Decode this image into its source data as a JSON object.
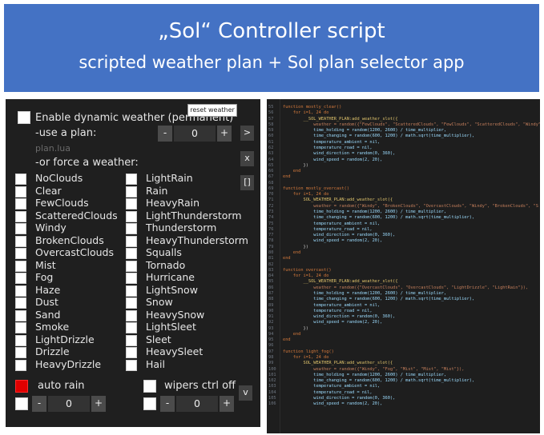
{
  "banner": {
    "title": "„Sol“ Controller script",
    "subtitle": "scripted weather plan + Sol plan selector app"
  },
  "app": {
    "tooltip": "reset weather",
    "enable_label": "Enable dynamic weather (permanent)",
    "use_plan_label": "-use a plan:",
    "plan_value": "0",
    "plan_file": "plan.lua",
    "force_label": "-or force a weather:",
    "next_button": ">",
    "close_button": "x",
    "brackets_button": "[]",
    "v_button": "v",
    "minus": "-",
    "plus": "+",
    "weathers_left": [
      "NoClouds",
      "Clear",
      "FewClouds",
      "ScatteredClouds",
      "Windy",
      "BrokenClouds",
      "OvercastClouds",
      "Mist",
      "Fog",
      "Haze",
      "Dust",
      "Sand",
      "Smoke",
      "LightDrizzle",
      "Drizzle",
      "HeavyDrizzle"
    ],
    "weathers_right": [
      "LightRain",
      "Rain",
      "HeavyRain",
      "LightThunderstorm",
      "Thunderstorm",
      "HeavyThunderstorm",
      "Squalls",
      "Tornado",
      "Hurricane",
      "LightSnow",
      "Snow",
      "HeavySnow",
      "LightSleet",
      "Sleet",
      "HeavySleet",
      "Hail"
    ],
    "auto_rain_label": "auto rain",
    "auto_rain_value": "0",
    "wipers_label": "wipers ctrl off",
    "wipers_value": "0",
    "colors": {
      "accent_red": "#e00000",
      "panel": "#1f1f1f",
      "banner": "#4472c4"
    }
  },
  "code": {
    "lines": [
      {
        "n": "55",
        "t": "function mostly_clear()"
      },
      {
        "n": "56",
        "t": "    for i=1, 24 do"
      },
      {
        "n": "57",
        "t": "        __SOL_WEATHER_PLAN:add_weather_slot({"
      },
      {
        "n": "58",
        "t": "            weather = random({\"FewClouds\", \"ScatteredClouds\", \"FewClouds\", \"ScatteredClouds\", \"Windy\""
      },
      {
        "n": "59",
        "t": "            time_holding = random(1200, 2600) / time_multiplier,"
      },
      {
        "n": "60",
        "t": "            time_changing = random(600, 1200) / math.sqrt(time_multiplier),"
      },
      {
        "n": "61",
        "t": "            temperature_ambient = nil,"
      },
      {
        "n": "62",
        "t": "            temperature_road = nil,"
      },
      {
        "n": "63",
        "t": "            wind_direction = random(0, 360),"
      },
      {
        "n": "64",
        "t": "            wind_speed = random(2, 20),"
      },
      {
        "n": "65",
        "t": "        })"
      },
      {
        "n": "66",
        "t": "    end"
      },
      {
        "n": "67",
        "t": "end"
      },
      {
        "n": "68",
        "t": ""
      },
      {
        "n": "69",
        "t": "function mostly_overcast()"
      },
      {
        "n": "70",
        "t": "    for i=1, 24 do"
      },
      {
        "n": "71",
        "t": "        SOL_WEATHER_PLAN:add_weather_slot({"
      },
      {
        "n": "72",
        "t": "            weather = random({\"Windy\", \"BrokenClouds\", \"OvercastClouds\", \"Windy\", \"BrokenClouds\", \"S"
      },
      {
        "n": "73",
        "t": "            time_holding = random(1200, 2600) / time_multiplier,"
      },
      {
        "n": "74",
        "t": "            time_changing = random(600, 1200) / math.sqrt(time_multiplier),"
      },
      {
        "n": "75",
        "t": "            temperature_ambient = nil,"
      },
      {
        "n": "76",
        "t": "            temperature_road = nil,"
      },
      {
        "n": "77",
        "t": "            wind_direction = random(0, 360),"
      },
      {
        "n": "78",
        "t": "            wind_speed = random(2, 20),"
      },
      {
        "n": "79",
        "t": "        })"
      },
      {
        "n": "80",
        "t": "    end"
      },
      {
        "n": "81",
        "t": "end"
      },
      {
        "n": "82",
        "t": ""
      },
      {
        "n": "83",
        "t": "function overcast()"
      },
      {
        "n": "84",
        "t": "    for i=1, 24 do"
      },
      {
        "n": "85",
        "t": "        __SOL_WEATHER_PLAN:add_weather_slot({"
      },
      {
        "n": "86",
        "t": "            weather = random({\"OvercastClouds\", \"OvercastClouds\", \"LightDrizzle\", \"LightRain\"}),"
      },
      {
        "n": "87",
        "t": "            time_holding = random(1200, 2600) / time_multiplier,"
      },
      {
        "n": "88",
        "t": "            time_changing = random(600, 1200) / math.sqrt(time_multiplier),"
      },
      {
        "n": "89",
        "t": "            temperature_ambient = nil,"
      },
      {
        "n": "90",
        "t": "            temperature_road = nil,"
      },
      {
        "n": "91",
        "t": "            wind_direction = random(0, 360),"
      },
      {
        "n": "92",
        "t": "            wind_speed = random(2, 20),"
      },
      {
        "n": "93",
        "t": "        })"
      },
      {
        "n": "94",
        "t": "    end"
      },
      {
        "n": "95",
        "t": "end"
      },
      {
        "n": "96",
        "t": ""
      },
      {
        "n": "97",
        "t": "function light_fog()"
      },
      {
        "n": "98",
        "t": "    for i=1, 24 do"
      },
      {
        "n": "99",
        "t": "        SOL_WEATHER_PLAN:add_weather_slot({"
      },
      {
        "n": "100",
        "t": "            weather = random({\"Windy\", \"Fog\", \"Mist\", \"Mist\", \"Mist\"}),"
      },
      {
        "n": "101",
        "t": "            time_holding = random(1200, 2600) / time_multiplier,"
      },
      {
        "n": "102",
        "t": "            time_changing = random(600, 1200) / math.sqrt(time_multiplier),"
      },
      {
        "n": "103",
        "t": "            temperature_ambient = nil,"
      },
      {
        "n": "104",
        "t": "            temperature_road = nil,"
      },
      {
        "n": "105",
        "t": "            wind_direction = random(0, 360),"
      },
      {
        "n": "106",
        "t": "            wind_speed = random(2, 20),"
      }
    ]
  }
}
